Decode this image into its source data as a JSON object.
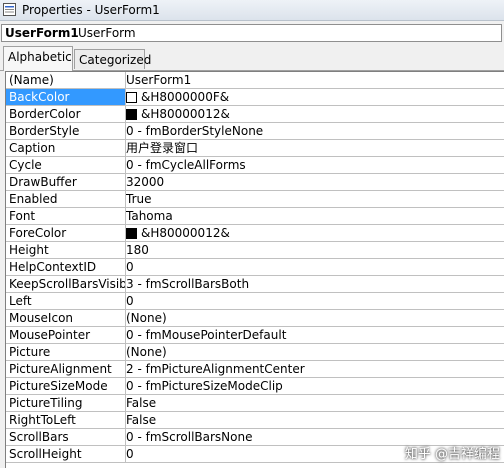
{
  "window": {
    "title": "Properties - UserForm1"
  },
  "object": {
    "name": "UserForm1",
    "type": "UserForm"
  },
  "tabs": [
    {
      "label": "Alphabetic",
      "active": true
    },
    {
      "label": "Categorized",
      "active": false
    }
  ],
  "properties": [
    {
      "name": "(Name)",
      "value": "UserForm1"
    },
    {
      "name": "BackColor",
      "value": "&H8000000F&",
      "swatch": "#ffffff",
      "selected": true
    },
    {
      "name": "BorderColor",
      "value": "&H80000012&",
      "swatch": "#000000"
    },
    {
      "name": "BorderStyle",
      "value": "0 - fmBorderStyleNone"
    },
    {
      "name": "Caption",
      "value": "用户登录窗口"
    },
    {
      "name": "Cycle",
      "value": "0 - fmCycleAllForms"
    },
    {
      "name": "DrawBuffer",
      "value": "32000"
    },
    {
      "name": "Enabled",
      "value": "True"
    },
    {
      "name": "Font",
      "value": "Tahoma"
    },
    {
      "name": "ForeColor",
      "value": "&H80000012&",
      "swatch": "#000000"
    },
    {
      "name": "Height",
      "value": "180"
    },
    {
      "name": "HelpContextID",
      "value": "0"
    },
    {
      "name": "KeepScrollBarsVisible",
      "value": "3 - fmScrollBarsBoth"
    },
    {
      "name": "Left",
      "value": "0"
    },
    {
      "name": "MouseIcon",
      "value": "(None)"
    },
    {
      "name": "MousePointer",
      "value": "0 - fmMousePointerDefault"
    },
    {
      "name": "Picture",
      "value": "(None)"
    },
    {
      "name": "PictureAlignment",
      "value": "2 - fmPictureAlignmentCenter"
    },
    {
      "name": "PictureSizeMode",
      "value": "0 - fmPictureSizeModeClip"
    },
    {
      "name": "PictureTiling",
      "value": "False"
    },
    {
      "name": "RightToLeft",
      "value": "False"
    },
    {
      "name": "ScrollBars",
      "value": "0 - fmScrollBarsNone"
    },
    {
      "name": "ScrollHeight",
      "value": "0"
    }
  ],
  "watermark": {
    "text": "知乎 @吉祥编程"
  },
  "colors": {
    "selection": "#3399ff",
    "grid_line": "#c0c0c0"
  }
}
